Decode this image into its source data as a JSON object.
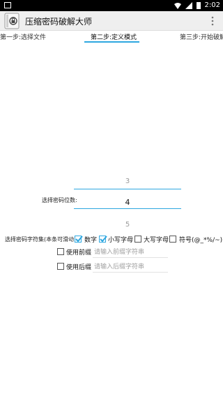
{
  "status_bar": {
    "time": "2:02"
  },
  "toolbar": {
    "title": "压缩密码破解大师"
  },
  "tabs": [
    {
      "label": "第一步:选择文件"
    },
    {
      "label": "第二步:定义模式"
    },
    {
      "label": "第三步:开始破解"
    }
  ],
  "digits": {
    "label": "选择密码位数:",
    "prev": "3",
    "current": "4",
    "next": "5"
  },
  "charset": {
    "label": "选择密码字符集(本条可滑动):",
    "options": [
      {
        "label": "数字",
        "checked": true
      },
      {
        "label": "小写字母",
        "checked": true
      },
      {
        "label": "大写字母",
        "checked": false
      },
      {
        "label": "符号(@_*%/~)",
        "checked": false
      }
    ]
  },
  "prefix": {
    "label": "使用前缀",
    "placeholder": "请输入前缀字符串",
    "checked": false
  },
  "suffix": {
    "label": "使用后缀",
    "placeholder": "请输入后缀字符串",
    "checked": false
  },
  "colors": {
    "accent": "#2ea7e0",
    "toolbar_bg": "#efefef",
    "status_bg": "#000000"
  }
}
